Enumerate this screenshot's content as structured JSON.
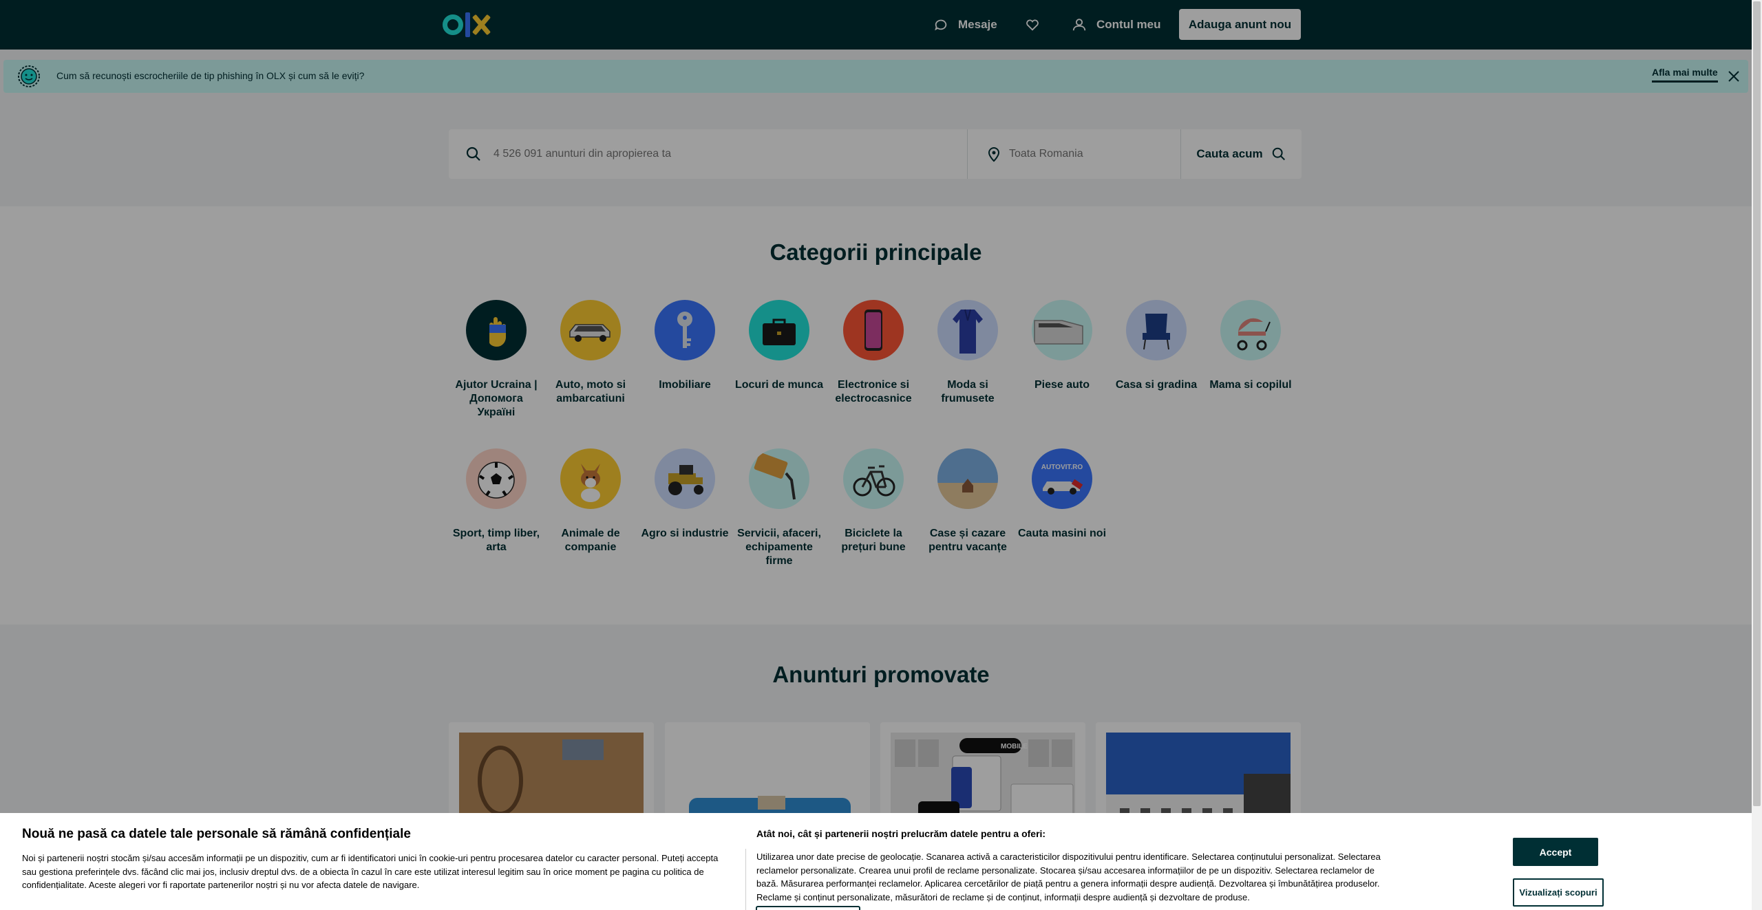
{
  "header": {
    "messages": "Mesaje",
    "account": "Contul meu",
    "add_ad": "Adauga anunt nou"
  },
  "banner": {
    "text": "Cum să recunoști escrocheriile de tip phishing în OLX și cum să le eviți?",
    "link": "Afla mai multe"
  },
  "search": {
    "placeholder": "4 526 091 anunturi din apropierea ta",
    "location_placeholder": "Toata Romania",
    "button": "Cauta acum"
  },
  "categories": {
    "title": "Categorii principale",
    "items": [
      {
        "label": "Ajutor Ucraina | Допомога Україні",
        "color": "#002f34"
      },
      {
        "label": "Auto, moto si ambarcatiuni",
        "color": "#ffce32"
      },
      {
        "label": "Imobiliare",
        "color": "#3a77ff"
      },
      {
        "label": "Locuri de munca",
        "color": "#23e5db"
      },
      {
        "label": "Electronice si electrocasnice",
        "color": "#ff5636"
      },
      {
        "label": "Moda si frumusete",
        "color": "#ceddff"
      },
      {
        "label": "Piese auto",
        "color": "#c8f8f6"
      },
      {
        "label": "Casa si gradina",
        "color": "#ceddff"
      },
      {
        "label": "Mama si copilul",
        "color": "#c8f8f6"
      },
      {
        "label": "Sport, timp liber, arta",
        "color": "#ffd6c9"
      },
      {
        "label": "Animale de companie",
        "color": "#ffce32"
      },
      {
        "label": "Agro si industrie",
        "color": "#ceddff"
      },
      {
        "label": "Servicii, afaceri, echipamente firme",
        "color": "#c8f8f6"
      },
      {
        "label": "Biciclete la prețuri bune",
        "color": "#c8f8f6"
      },
      {
        "label": "Case și cazare pentru vacanțe",
        "color": "#ceddff"
      },
      {
        "label": "Cauta masini noi",
        "color": "#3a77ff"
      }
    ]
  },
  "promoted": {
    "title": "Anunturi promovate",
    "card3_badge": "MOBILE"
  },
  "cookie": {
    "title": "Nouă ne pasă ca datele tale personale să rămână confidențiale",
    "text": "Noi și partenerii noștri stocăm și/sau accesăm informații pe un dispozitiv, cum ar fi identificatori unici în cookie-uri pentru procesarea datelor cu caracter personal. Puteți accepta sau gestiona preferințele dvs. făcând clic mai jos, inclusiv dreptul dvs. de a obiecta în cazul în care este utilizat interesul legitim sau în orice moment pe pagina cu politica de confidențialitate. Aceste alegeri vor fi raportate partenerilor noștri și nu vor afecta datele de navigare.",
    "right_title": "Atât noi, cât și partenerii noștri prelucrăm datele pentru a oferi:",
    "right_text": "Utilizarea unor date precise de geolocație. Scanarea activă a caracteristicilor dispozitivului pentru identificare. Selectarea conținutului personalizat. Selectarea reclamelor personalizate. Crearea unui profil de reclame personalizate. Stocarea și/sau accesarea informațiilor de pe un dispozitiv. Selectarea reclamelor de bază. Măsurarea performanței reclamelor. Aplicarea cercetărilor de piață pentru a genera informații despre audiență. Dezvoltarea și îmbunătățirea produselor. Reclame și conținut personalizate, măsurători de reclame și de conținut, informații despre audiență și dezvoltare de produse.",
    "accept": "Accept",
    "purposes": "Vizualizați scopuri"
  }
}
